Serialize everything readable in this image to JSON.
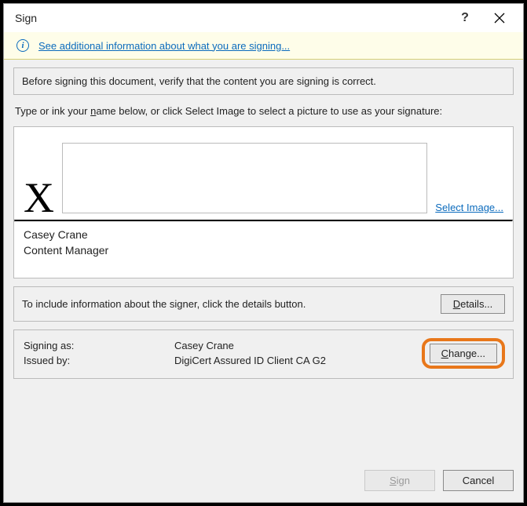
{
  "titlebar": {
    "title": "Sign",
    "help_label": "?",
    "close_label": "×"
  },
  "info_bar": {
    "link_text": "See additional information about what you are signing..."
  },
  "verify_panel": {
    "text": "Before signing this document, verify that the content you are signing is correct."
  },
  "instruction": "Type or ink your name below, or click Select Image to select a picture to use as your signature:",
  "signature": {
    "x_mark": "X",
    "select_image_label": "Select Image...",
    "signer_name": "Casey Crane",
    "signer_title": "Content Manager"
  },
  "details_row": {
    "text": "To include information about the signer, click the details button.",
    "button_label": "Details..."
  },
  "cert": {
    "signing_as_label": "Signing as:",
    "signing_as_value": "Casey Crane",
    "issued_by_label": "Issued by:",
    "issued_by_value": "DigiCert Assured ID Client CA G2",
    "change_label": "Change..."
  },
  "footer": {
    "sign_label": "Sign",
    "cancel_label": "Cancel"
  }
}
